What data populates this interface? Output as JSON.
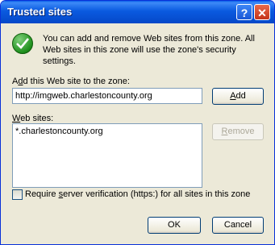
{
  "window": {
    "title": "Trusted sites"
  },
  "titlebar": {
    "help_label": "?",
    "close_label": "✕"
  },
  "info": {
    "text": "You can add and remove Web sites from this zone. All Web sites in this zone will use the zone's security settings."
  },
  "add_site": {
    "label_pre": "",
    "label_key": "d",
    "label_post": "d this Web site to the zone:",
    "label_prefix": "A",
    "value": "http://imgweb.charlestoncounty.org",
    "button_key": "A",
    "button_post": "dd"
  },
  "sites": {
    "label_key": "W",
    "label_post": "eb sites:",
    "items": [
      "*.charlestoncounty.org"
    ],
    "remove_key": "R",
    "remove_post": "emove"
  },
  "verification": {
    "label_pre": "Require ",
    "label_key": "s",
    "label_post": "erver verification (https:) for all sites in this zone",
    "checked": false
  },
  "footer": {
    "ok_label": "OK",
    "cancel_label": "Cancel"
  }
}
